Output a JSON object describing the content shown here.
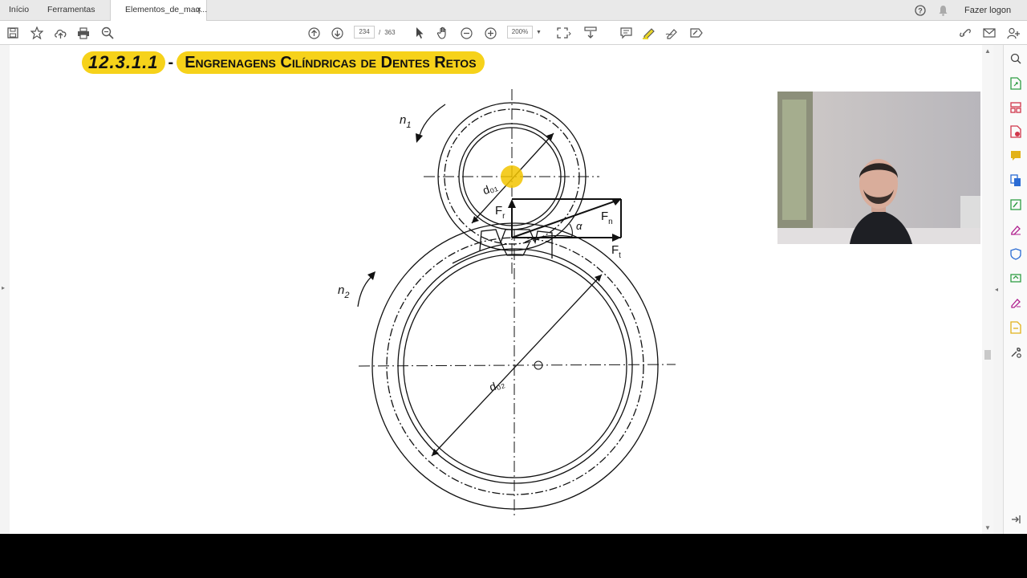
{
  "tabs": {
    "home": "Início",
    "tools": "Ferramentas",
    "document": "Elementos_de_maq...",
    "close": "×"
  },
  "header": {
    "login": "Fazer logon"
  },
  "toolbar": {
    "current_page": "234",
    "page_separator": "/",
    "total_pages": "363",
    "zoom": "200%"
  },
  "document": {
    "section_number": "12.3.1.1",
    "section_dash": "-",
    "section_title": "Engrenagens Cilíndricas de Dentes Retos"
  },
  "diagram": {
    "labels": {
      "n1": "n",
      "n1_sub": "1",
      "n2": "n",
      "n2_sub": "2",
      "d01": "d₀₁",
      "d02": "d₀₂",
      "fr": "F",
      "fr_sub": "r",
      "fn": "F",
      "fn_sub": "n",
      "ft": "F",
      "ft_sub": "t",
      "alpha": "α"
    }
  },
  "colors": {
    "highlight": "#f6d21a",
    "pointer": "#f2c400",
    "accent_purple": "#b0208f",
    "accent_green": "#2f9e44",
    "accent_blue": "#2b6cd4",
    "accent_red": "#d1364b",
    "accent_yellow": "#e2b21a"
  }
}
